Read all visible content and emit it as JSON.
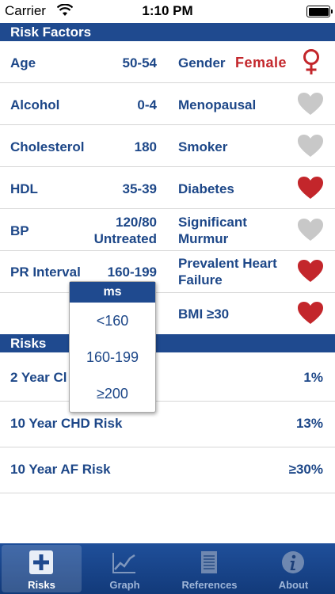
{
  "status_bar": {
    "carrier": "Carrier",
    "time": "1:10 PM"
  },
  "sections": {
    "risk_factors": "Risk Factors",
    "risks": "Risks"
  },
  "factors": {
    "age": {
      "label": "Age",
      "value": "50-54"
    },
    "gender": {
      "label": "Gender",
      "value": "Female"
    },
    "alcohol": {
      "label": "Alcohol",
      "value": "0-4"
    },
    "menopausal": {
      "label": "Menopausal",
      "active": false
    },
    "cholesterol": {
      "label": "Cholesterol",
      "value": "180"
    },
    "smoker": {
      "label": "Smoker",
      "active": false
    },
    "hdl": {
      "label": "HDL",
      "value": "35-39"
    },
    "diabetes": {
      "label": "Diabetes",
      "active": true
    },
    "bp": {
      "label": "BP",
      "value_line1": "120/80",
      "value_line2": "Untreated"
    },
    "murmur": {
      "label_line1": "Significant",
      "label_line2": "Murmur",
      "active": false
    },
    "pr_interval": {
      "label": "PR Interval",
      "value": "160-199"
    },
    "heart_failure": {
      "label_line1": "Prevalent Heart",
      "label_line2": "Failure",
      "active": true
    },
    "bmi": {
      "label": "BMI ≥30",
      "active": true
    }
  },
  "risks": [
    {
      "label": "2 Year Cl",
      "value": "1%"
    },
    {
      "label": "10 Year CHD Risk",
      "value": "13%"
    },
    {
      "label": "10 Year AF Risk",
      "value": "≥30%"
    }
  ],
  "picker": {
    "header": "ms",
    "options": [
      "<160",
      "160-199",
      "≥200"
    ]
  },
  "tabs": [
    {
      "label": "Risks",
      "icon": "plus-icon",
      "active": true
    },
    {
      "label": "Graph",
      "icon": "graph-icon",
      "active": false
    },
    {
      "label": "References",
      "icon": "document-icon",
      "active": false
    },
    {
      "label": "About",
      "icon": "info-icon",
      "active": false
    }
  ],
  "colors": {
    "header_blue": "#1f4a8f",
    "text_blue": "#1d4788",
    "heart_red": "#c3262b",
    "heart_gray": "#c8c8c8"
  }
}
